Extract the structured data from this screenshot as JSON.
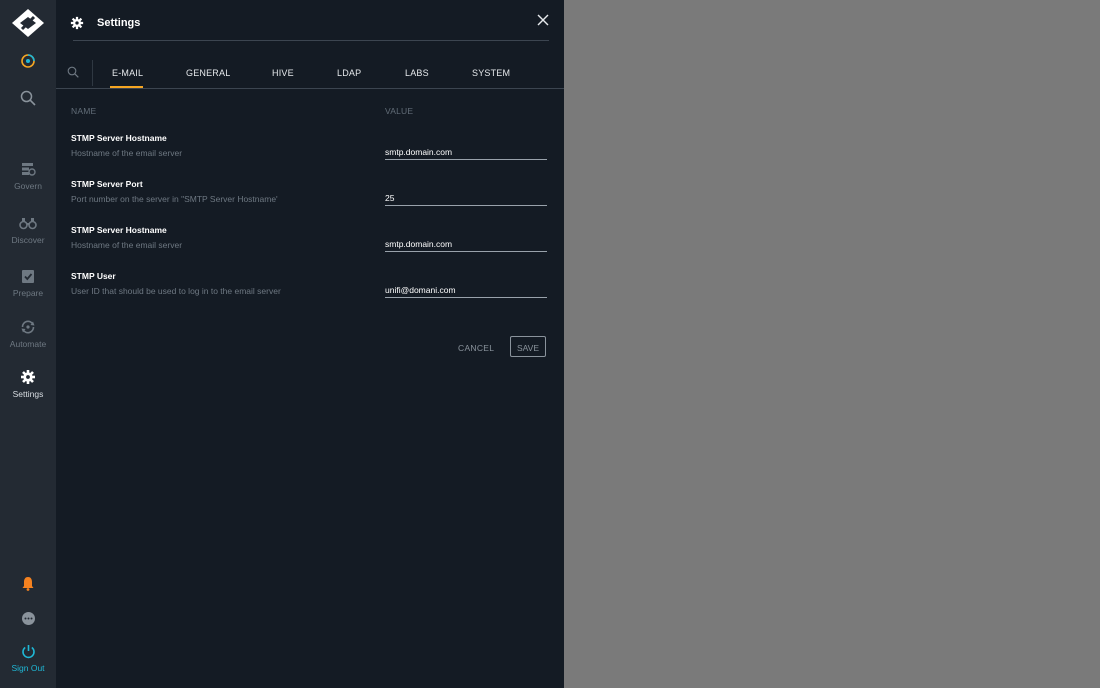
{
  "rail": {
    "items": [
      {
        "label": "Govern"
      },
      {
        "label": "Discover"
      },
      {
        "label": "Prepare"
      },
      {
        "label": "Automate"
      },
      {
        "label": "Settings"
      }
    ],
    "signout_label": "Sign Out"
  },
  "panel": {
    "title": "Settings",
    "tabs": [
      {
        "label": "E-MAIL",
        "active": true
      },
      {
        "label": "GENERAL"
      },
      {
        "label": "HIVE"
      },
      {
        "label": "LDAP"
      },
      {
        "label": "LABS"
      },
      {
        "label": "SYSTEM"
      }
    ],
    "columns": {
      "name": "NAME",
      "value": "VALUE"
    },
    "rows": [
      {
        "label": "STMP Server Hostname",
        "description": "Hostname of the email server",
        "value": "smtp.domain.com"
      },
      {
        "label": "STMP Server Port",
        "description": "Port number on the server in \"SMTP Server Hostname'",
        "value": "25"
      },
      {
        "label": "STMP Server Hostname",
        "description": "Hostname of the email server",
        "value": "smtp.domain.com"
      },
      {
        "label": "STMP User",
        "description": "User ID that should be used to log in to the email server",
        "value": "unifi@domani.com"
      }
    ],
    "cancel_label": "CANCEL",
    "save_label": "SAVE"
  },
  "colors": {
    "accent_tab": "#f5a623",
    "notification": "#f58220",
    "signout": "#1fb8d6",
    "panel_bg": "#141b24",
    "rail_bg": "#232a33"
  }
}
